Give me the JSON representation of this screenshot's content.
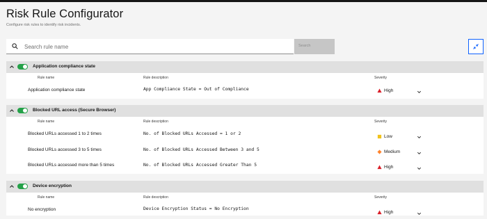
{
  "page": {
    "title": "Risk Rule Configurator",
    "subtitle": "Configure risk rules to identify risk incidents."
  },
  "search": {
    "placeholder": "Search rule name",
    "button_label": "Search"
  },
  "icons": {
    "search": "search-icon",
    "collapse_all": "collapse-icon",
    "group_expand": "chevron-up-icon",
    "severity_dropdown": "chevron-down-icon",
    "high": "triangle-icon",
    "medium": "diamond-icon",
    "low": "square-icon"
  },
  "colors": {
    "toggle_on": "#24a148",
    "high": "#da1e28",
    "medium": "#ff832b",
    "low": "#f1c21b",
    "accent": "#0f62fe"
  },
  "columns": {
    "name": "Rule name",
    "description": "Rule description",
    "severity": "Severity"
  },
  "groups": [
    {
      "title": "Application compliance state",
      "enabled": true,
      "rules": [
        {
          "name": "Application compliance state",
          "description": "App Compliance State = Out of Compliance",
          "severity": "High"
        }
      ]
    },
    {
      "title": "Blocked URL access (Secure Browser)",
      "enabled": true,
      "rules": [
        {
          "name": "Blocked URLs accessed 1 to 2 times",
          "description": "No. of Blocked URLs Accessed = 1 or 2",
          "severity": "Low"
        },
        {
          "name": "Blocked URLs accessed 3 to 5 times",
          "description": "No. of Blocked URLs Accessed Between 3 and 5",
          "severity": "Medium"
        },
        {
          "name": "Blocked URLs accessed more than 5 times",
          "description": "No. of Blocked URLs Accessed Greater Than 5",
          "severity": "High"
        }
      ]
    },
    {
      "title": "Device encryption",
      "enabled": true,
      "rules": [
        {
          "name": "No encryption",
          "description": "Device Encryption Status = No Encryption",
          "severity": "High"
        }
      ]
    }
  ]
}
